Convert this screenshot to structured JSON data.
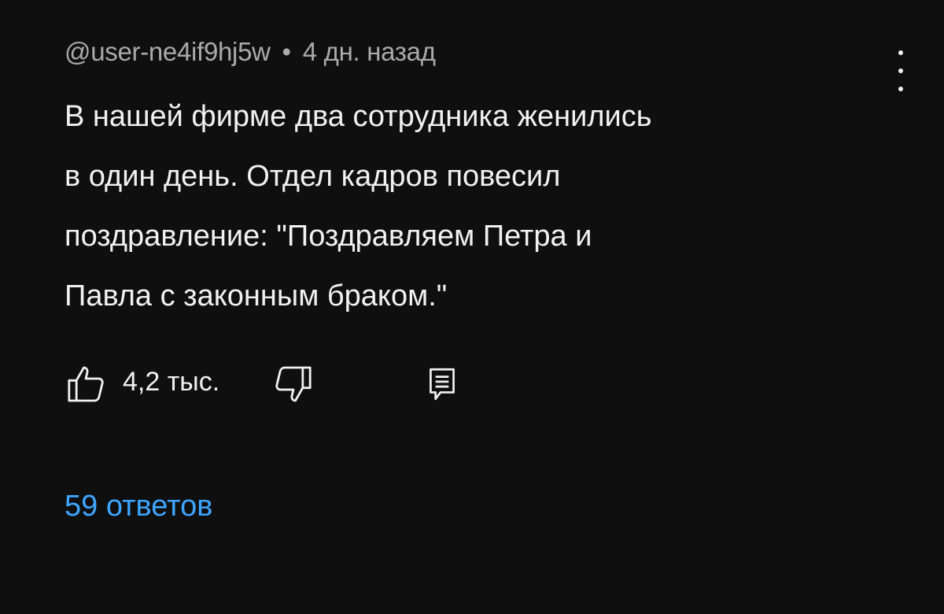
{
  "comment": {
    "author": "@user-ne4if9hj5w",
    "separator": "•",
    "time": "4 дн. назад",
    "text_lines": [
      "В нашей фирме два сотрудника женились",
      "в один день. Отдел кадров повесил",
      "поздравление: \"Поздравляем Петра и",
      "Павла с законным браком.\""
    ],
    "likes": "4,2 тыс.",
    "replies": "59 ответов"
  },
  "icons": {
    "like": "thumb-up-icon",
    "dislike": "thumb-down-icon",
    "reply": "comment-icon",
    "more": "more-vert-icon"
  },
  "colors": {
    "background": "#0f0f0f",
    "text": "#f1f1f1",
    "meta": "#aaaaaa",
    "link": "#3ea6ff"
  }
}
